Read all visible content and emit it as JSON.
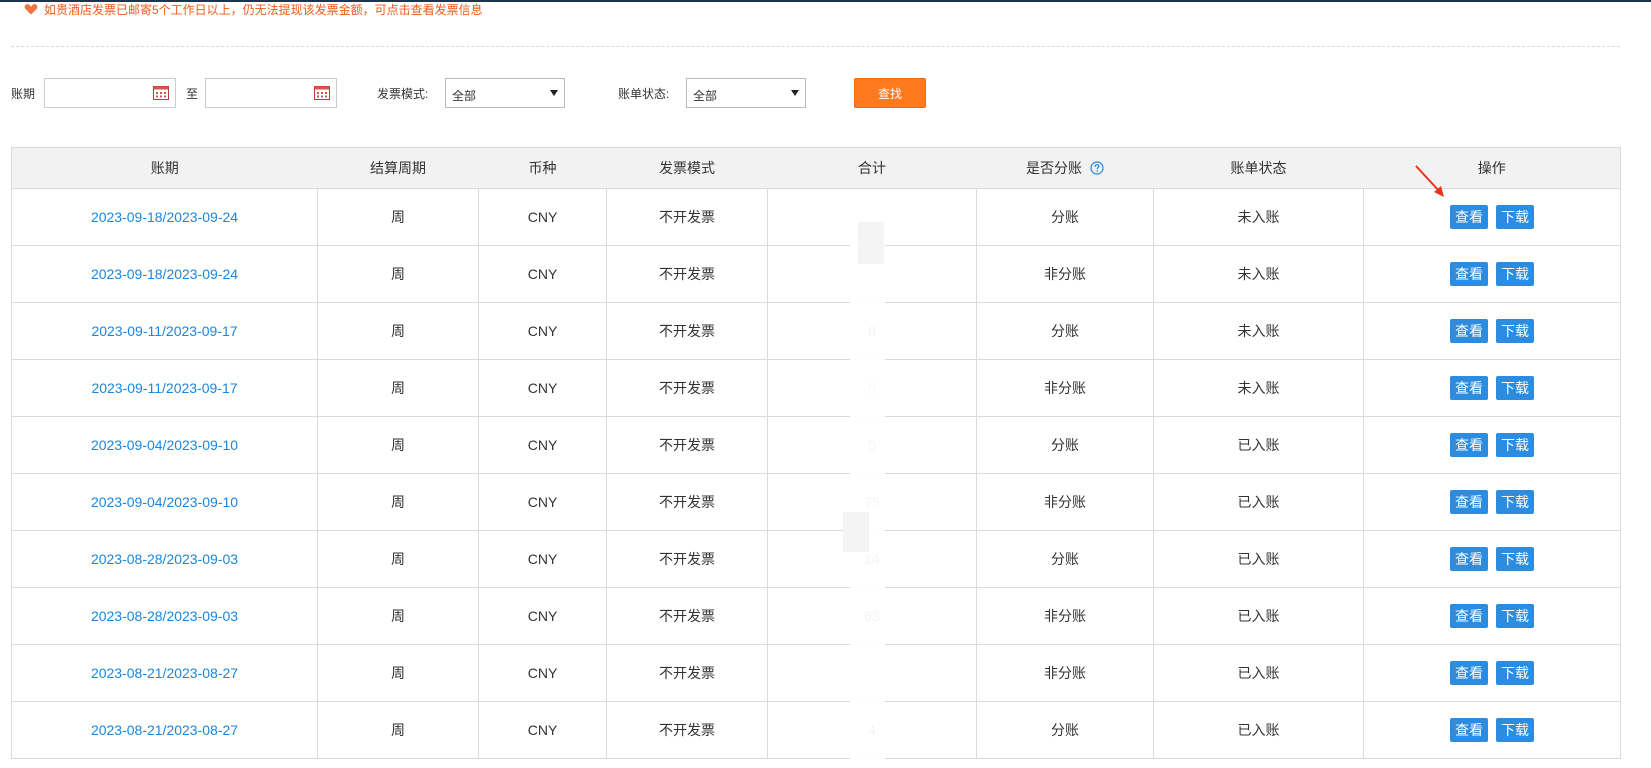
{
  "notice": {
    "text": "如贵酒店发票已邮寄5个工作日以上，仍无法提现该发票金额，可点击查看发票信息"
  },
  "filters": {
    "period_label": "账期",
    "to_label": "至",
    "start_value": "",
    "end_value": "",
    "invoice_mode_label": "发票模式:",
    "invoice_mode_value": "全部",
    "bill_status_label": "账单状态:",
    "bill_status_value": "全部",
    "search_label": "查找"
  },
  "table": {
    "headers": {
      "period": "账期",
      "cycle": "结算周期",
      "currency": "币种",
      "invoice_mode": "发票模式",
      "total": "合计",
      "split": "是否分账",
      "status": "账单状态",
      "ops": "操作"
    },
    "view_label": "查看",
    "download_label": "下载",
    "rows": [
      {
        "period": "2023-09-18/2023-09-24",
        "cycle": "周",
        "currency": "CNY",
        "invoice_mode": "不开发票",
        "total": "",
        "split": "分账",
        "status": "未入账"
      },
      {
        "period": "2023-09-18/2023-09-24",
        "cycle": "周",
        "currency": "CNY",
        "invoice_mode": "不开发票",
        "total": "",
        "split": "非分账",
        "status": "未入账"
      },
      {
        "period": "2023-09-11/2023-09-17",
        "cycle": "周",
        "currency": "CNY",
        "invoice_mode": "不开发票",
        "total": "8",
        "split": "分账",
        "status": "未入账"
      },
      {
        "period": "2023-09-11/2023-09-17",
        "cycle": "周",
        "currency": "CNY",
        "invoice_mode": "不开发票",
        "total": "5",
        "split": "非分账",
        "status": "未入账"
      },
      {
        "period": "2023-09-04/2023-09-10",
        "cycle": "周",
        "currency": "CNY",
        "invoice_mode": "不开发票",
        "total": "5",
        "split": "分账",
        "status": "已入账"
      },
      {
        "period": "2023-09-04/2023-09-10",
        "cycle": "周",
        "currency": "CNY",
        "invoice_mode": "不开发票",
        "total": "75",
        "split": "非分账",
        "status": "已入账"
      },
      {
        "period": "2023-08-28/2023-09-03",
        "cycle": "周",
        "currency": "CNY",
        "invoice_mode": "不开发票",
        "total": "14",
        "split": "分账",
        "status": "已入账"
      },
      {
        "period": "2023-08-28/2023-09-03",
        "cycle": "周",
        "currency": "CNY",
        "invoice_mode": "不开发票",
        "total": "63",
        "split": "非分账",
        "status": "已入账"
      },
      {
        "period": "2023-08-21/2023-08-27",
        "cycle": "周",
        "currency": "CNY",
        "invoice_mode": "不开发票",
        "total": "",
        "split": "非分账",
        "status": "已入账"
      },
      {
        "period": "2023-08-21/2023-08-27",
        "cycle": "周",
        "currency": "CNY",
        "invoice_mode": "不开发票",
        "total": "4",
        "split": "分账",
        "status": "已入账"
      }
    ]
  },
  "colors": {
    "notice": "#f05a1a",
    "link": "#1a86e0",
    "search_button": "#ff7a1f",
    "op_button": "#2b8ce0",
    "arrow": "#e8321e"
  },
  "icons": [
    "heart-icon",
    "calendar-icon",
    "question-icon",
    "red-arrow-annotation"
  ]
}
